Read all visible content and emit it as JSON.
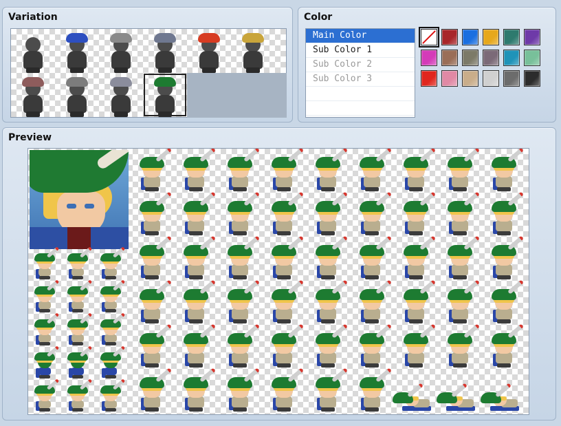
{
  "variation": {
    "title": "Variation",
    "items": [
      {
        "name": "none",
        "hat": null
      },
      {
        "name": "blue-bandana",
        "hat": "#2d4fc0"
      },
      {
        "name": "bird-hood",
        "hat": "#8a8a8a"
      },
      {
        "name": "goggles-cap",
        "hat": "#6f7890"
      },
      {
        "name": "red-feather-hat",
        "hat": "#d73c22"
      },
      {
        "name": "goggles",
        "hat": "#c9a53b"
      },
      {
        "name": "newsboy-cap",
        "hat": "#8e5c5c"
      },
      {
        "name": "horns",
        "hat": "#7c7c7c"
      },
      {
        "name": "grey-fedora",
        "hat": "#8b8d9c"
      },
      {
        "name": "green-feather-hat",
        "hat": "#1d7b31"
      }
    ],
    "selected_index": 9
  },
  "color": {
    "title": "Color",
    "options": [
      "Main Color",
      "Sub Color 1",
      "Sub Color 2",
      "Sub Color 3"
    ],
    "selected_index": 0,
    "disabled": [
      2,
      3
    ],
    "swatches": [
      "none",
      "#a8262a",
      "#1a6fe0",
      "#e6a81c",
      "#2e7a6e",
      "#6e3aa8",
      "#d43bb8",
      "#9a6e58",
      "#7c7a68",
      "#7b6a78",
      "#1f93b8",
      "#78c09a",
      "#e0261e",
      "#e089a5",
      "#c9ad8a",
      "#d0d0d0",
      "#6c6c6c",
      "#2c2c2c"
    ],
    "selected_swatch": 0
  },
  "preview": {
    "title": "Preview"
  }
}
